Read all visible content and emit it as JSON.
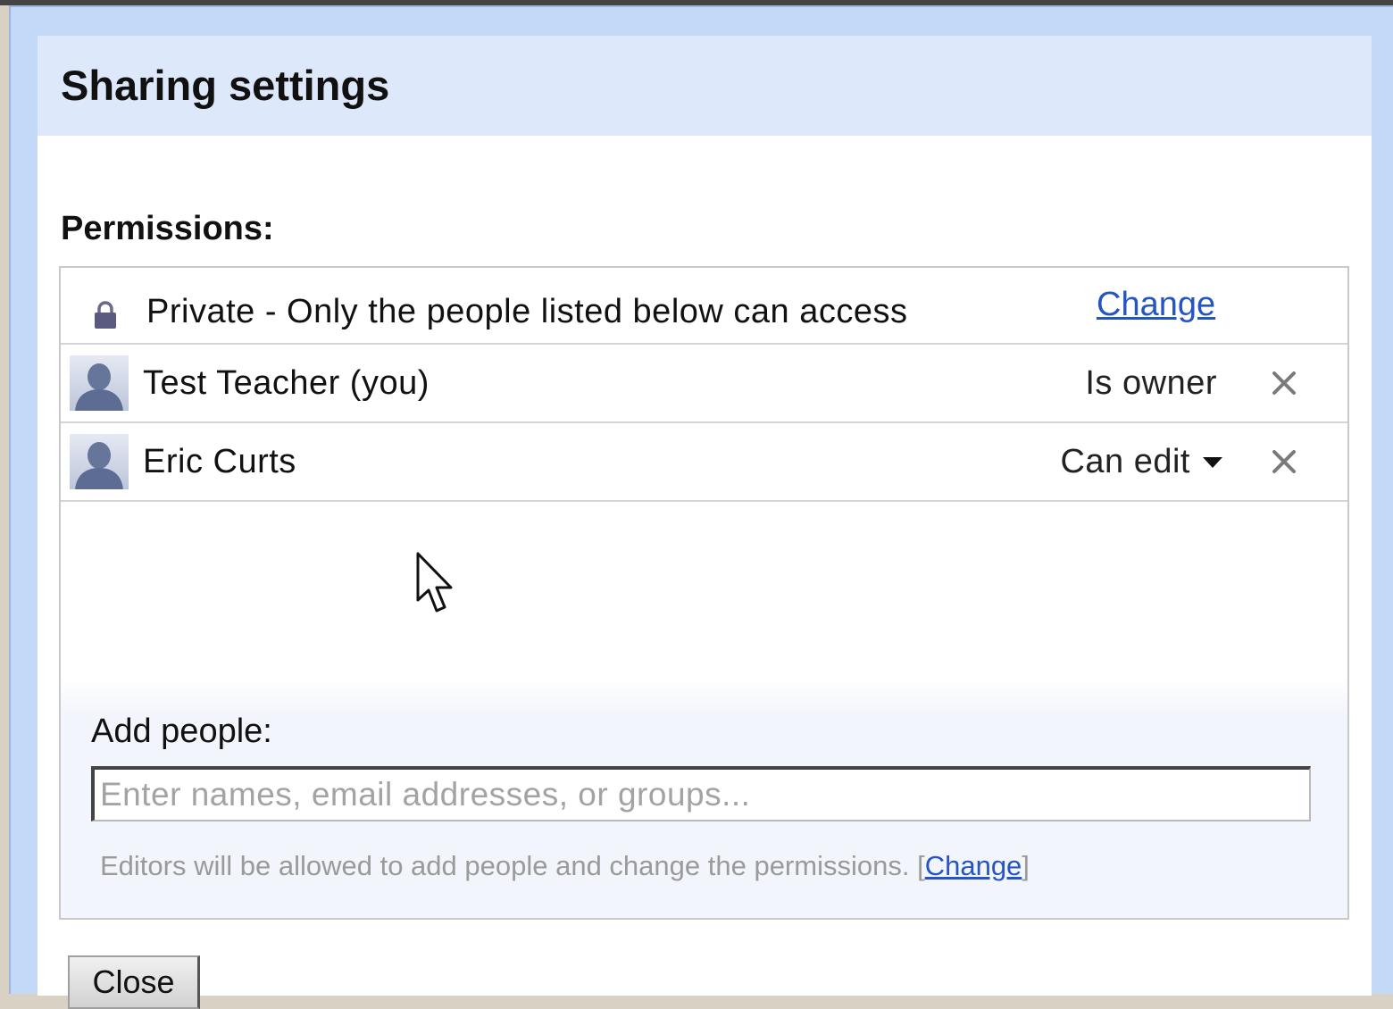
{
  "dialog": {
    "title": "Sharing settings",
    "permissions_label": "Permissions:",
    "visibility": {
      "icon": "lock-icon",
      "text": "Private - Only the people listed below can access",
      "change_label": "Change"
    },
    "people": [
      {
        "name": "Test Teacher (you)",
        "role": "Is owner",
        "role_editable": false
      },
      {
        "name": "Eric Curts",
        "role": "Can edit",
        "role_editable": true
      }
    ],
    "add_people": {
      "label": "Add people:",
      "placeholder": "Enter names, email addresses, or groups...",
      "value": ""
    },
    "editors_note": {
      "text": "Editors will be allowed to add people and change the permissions.",
      "open_bracket": "[",
      "change_label": "Change",
      "close_bracket": "]"
    },
    "close_label": "Close"
  },
  "colors": {
    "title_bar": "#dde8fa",
    "frame": "#c3d9f7",
    "link": "#2455c3"
  }
}
